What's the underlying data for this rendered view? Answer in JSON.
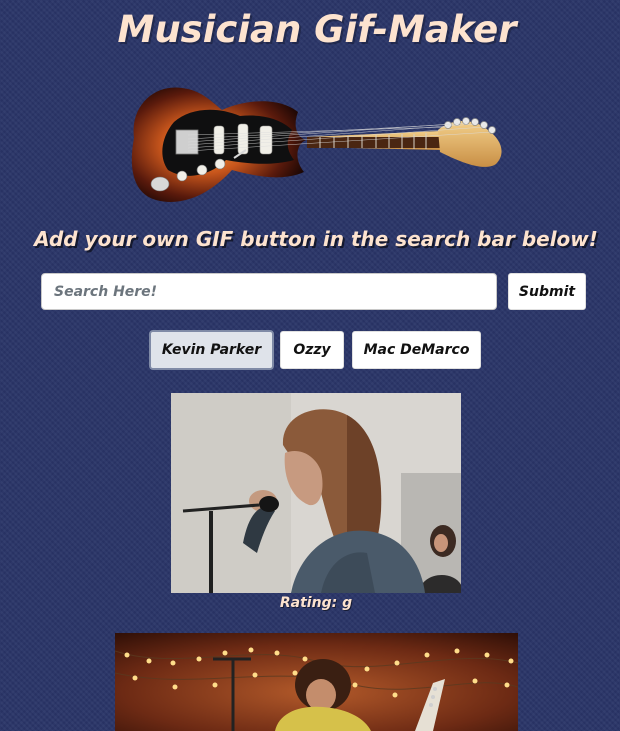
{
  "header": {
    "title": "Musician Gif-Maker",
    "subtitle": "Add your own GIF button in the search bar below!"
  },
  "images": {
    "banner": "electric-guitar",
    "gifs": [
      "singer-with-microphone",
      "guitarist-performing-with-string-lights"
    ]
  },
  "search": {
    "placeholder": "Search Here!",
    "value": "",
    "submit_label": "Submit"
  },
  "artists": [
    {
      "label": "Kevin Parker",
      "active": true
    },
    {
      "label": "Ozzy",
      "active": false
    },
    {
      "label": "Mac DeMarco",
      "active": false
    }
  ],
  "results": [
    {
      "rating_label": "Rating: g"
    }
  ],
  "colors": {
    "background": "#2a3568",
    "heading_text": "#fde3cf",
    "button_bg": "#ffffff",
    "active_button_bg": "#dfe3ea"
  }
}
